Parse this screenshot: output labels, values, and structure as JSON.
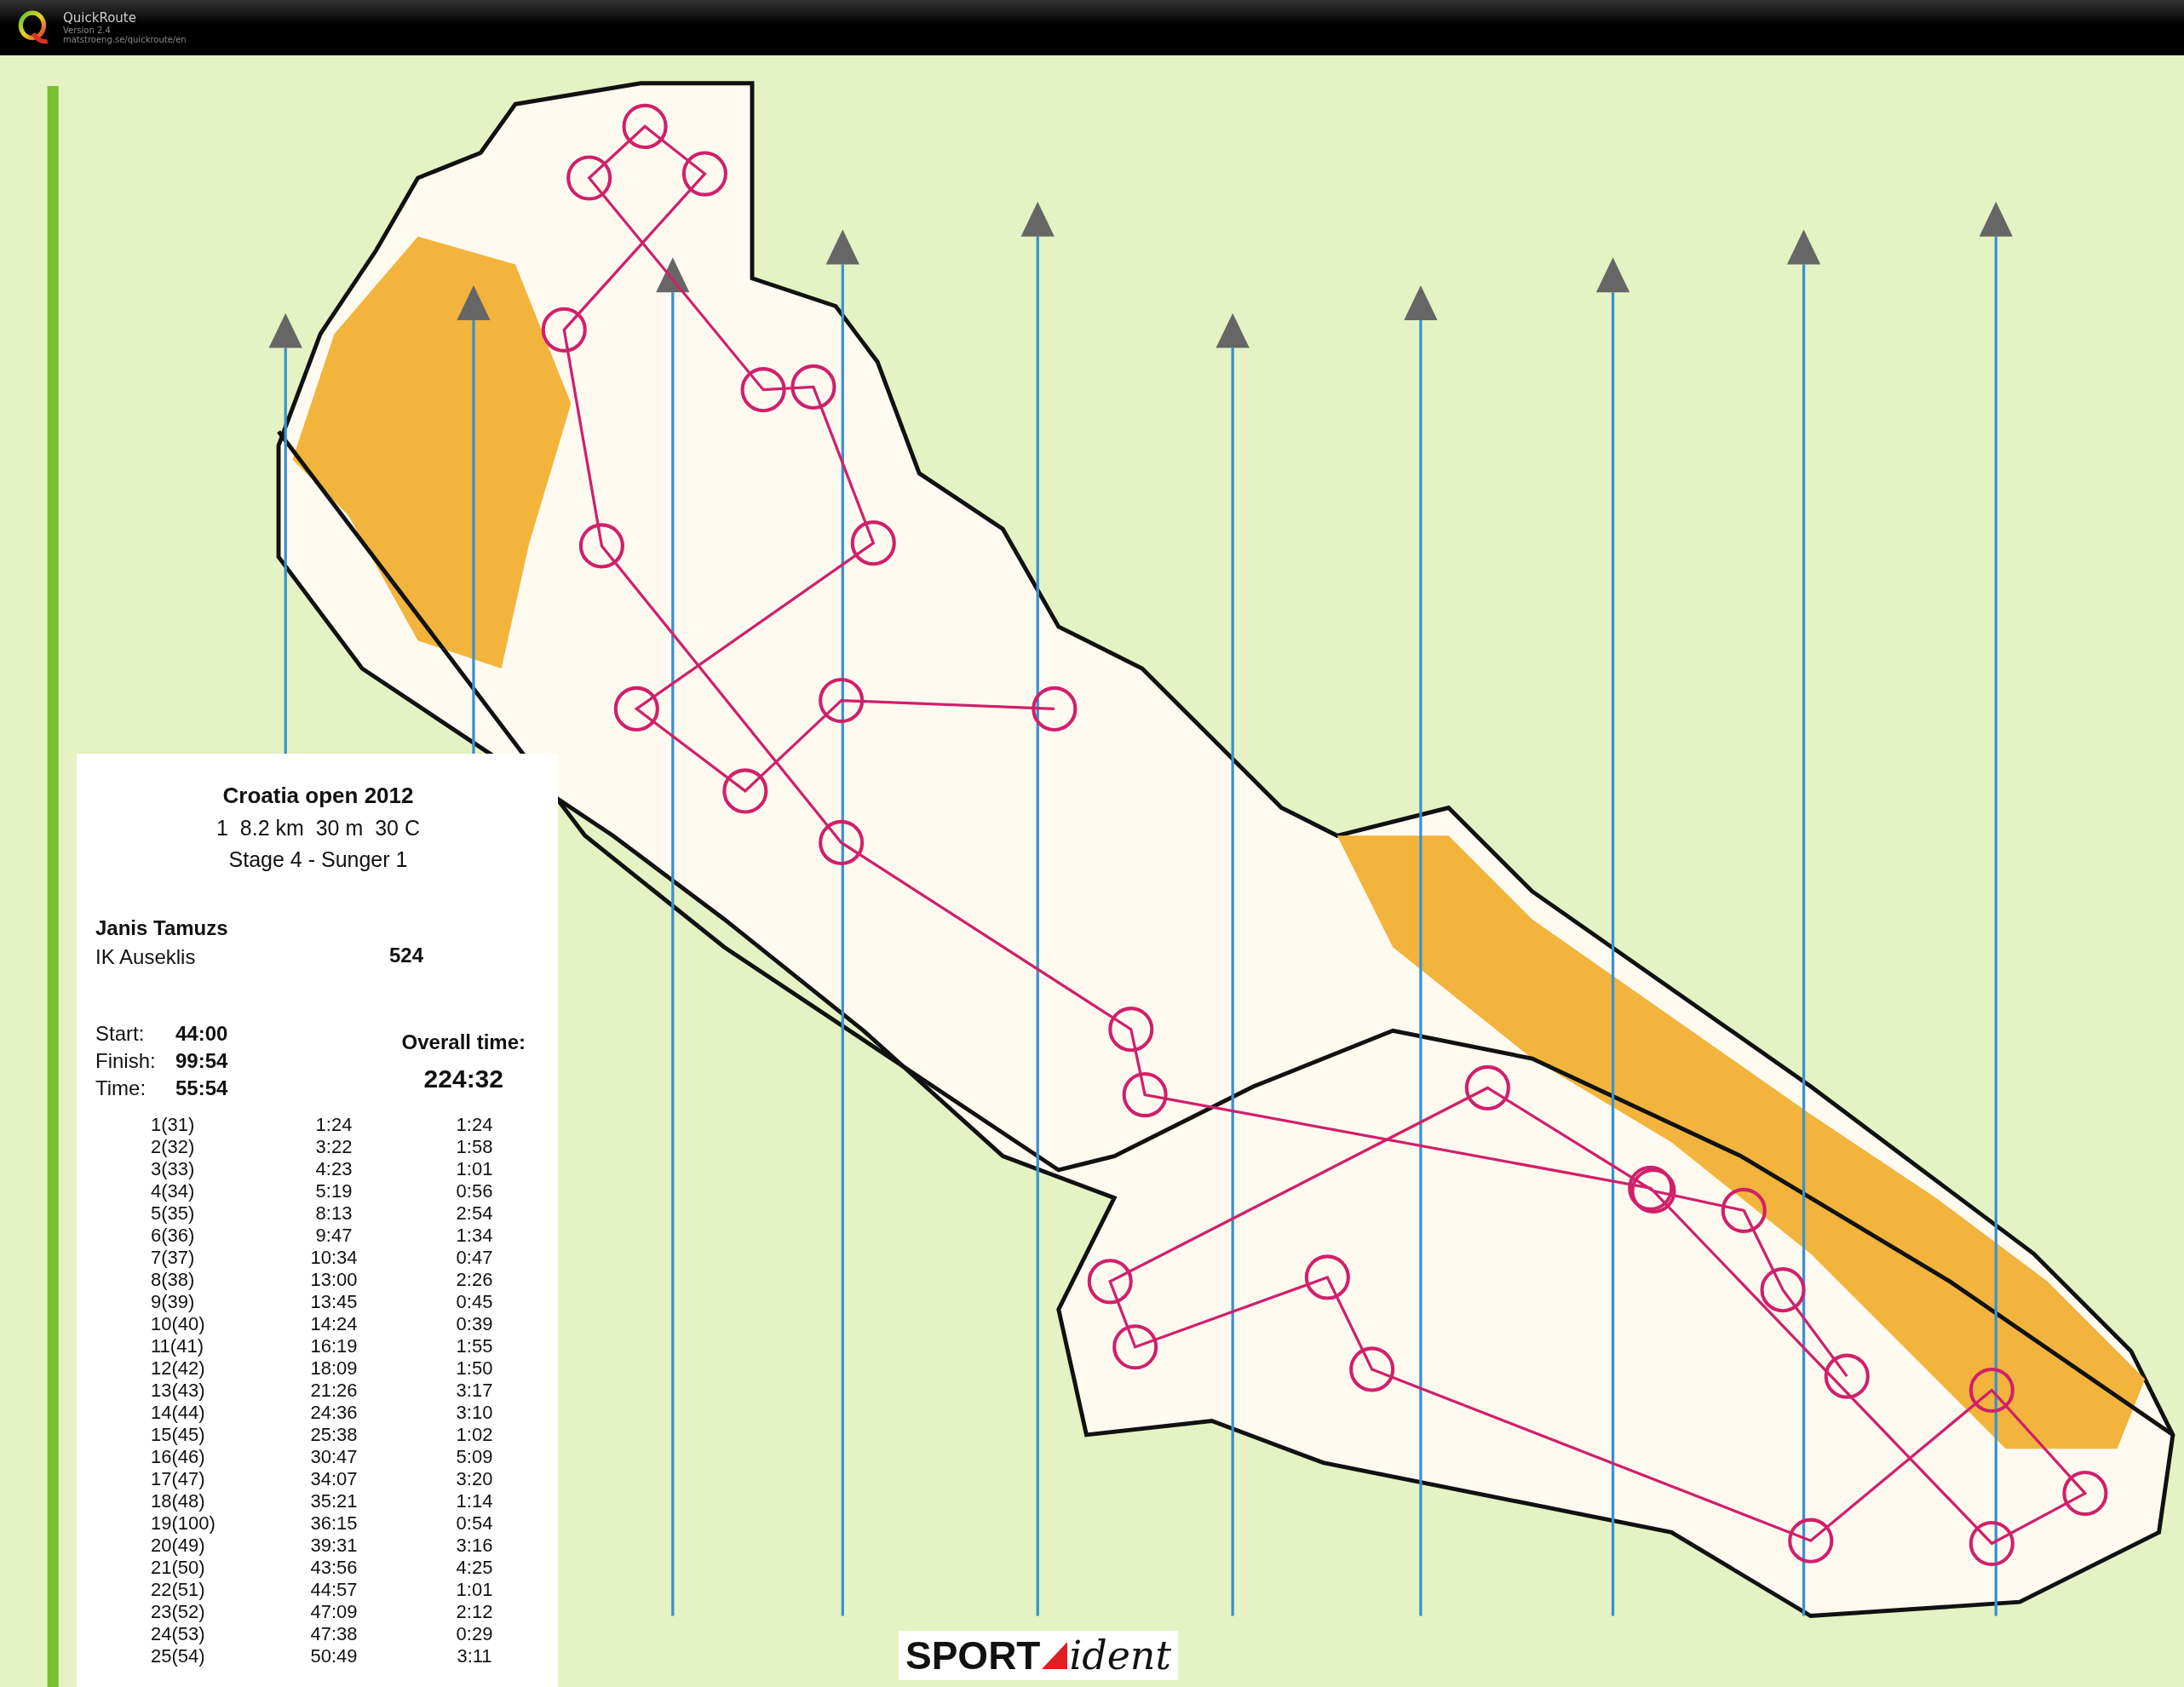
{
  "app": {
    "name": "QuickRoute",
    "version": "Version 2.4",
    "url": "matstroeng.se/quickroute/en"
  },
  "results": {
    "event": "Croatia open 2012",
    "course": "1  8.2 km  30 m  30 C",
    "stage": "Stage 4 - Sunger 1",
    "runner": "Janis Tamuzs",
    "club": "IK Auseklis",
    "bib": "524",
    "times": [
      {
        "label": "Start:",
        "value": "44:00"
      },
      {
        "label": "Finish:",
        "value": "99:54"
      },
      {
        "label": "Time:",
        "value": "55:54"
      }
    ],
    "overall": {
      "label": "Overall time:",
      "value": "224:32"
    },
    "splits": [
      {
        "control": "1(31)",
        "elapsed": "1:24",
        "leg": "1:24"
      },
      {
        "control": "2(32)",
        "elapsed": "3:22",
        "leg": "1:58"
      },
      {
        "control": "3(33)",
        "elapsed": "4:23",
        "leg": "1:01"
      },
      {
        "control": "4(34)",
        "elapsed": "5:19",
        "leg": "0:56"
      },
      {
        "control": "5(35)",
        "elapsed": "8:13",
        "leg": "2:54"
      },
      {
        "control": "6(36)",
        "elapsed": "9:47",
        "leg": "1:34"
      },
      {
        "control": "7(37)",
        "elapsed": "10:34",
        "leg": "0:47"
      },
      {
        "control": "8(38)",
        "elapsed": "13:00",
        "leg": "2:26"
      },
      {
        "control": "9(39)",
        "elapsed": "13:45",
        "leg": "0:45"
      },
      {
        "control": "10(40)",
        "elapsed": "14:24",
        "leg": "0:39"
      },
      {
        "control": "11(41)",
        "elapsed": "16:19",
        "leg": "1:55"
      },
      {
        "control": "12(42)",
        "elapsed": "18:09",
        "leg": "1:50"
      },
      {
        "control": "13(43)",
        "elapsed": "21:26",
        "leg": "3:17"
      },
      {
        "control": "14(44)",
        "elapsed": "24:36",
        "leg": "3:10"
      },
      {
        "control": "15(45)",
        "elapsed": "25:38",
        "leg": "1:02"
      },
      {
        "control": "16(46)",
        "elapsed": "30:47",
        "leg": "5:09"
      },
      {
        "control": "17(47)",
        "elapsed": "34:07",
        "leg": "3:20"
      },
      {
        "control": "18(48)",
        "elapsed": "35:21",
        "leg": "1:14"
      },
      {
        "control": "19(100)",
        "elapsed": "36:15",
        "leg": "0:54"
      },
      {
        "control": "20(49)",
        "elapsed": "39:31",
        "leg": "3:16"
      },
      {
        "control": "21(50)",
        "elapsed": "43:56",
        "leg": "4:25"
      },
      {
        "control": "22(51)",
        "elapsed": "44:57",
        "leg": "1:01"
      },
      {
        "control": "23(52)",
        "elapsed": "47:09",
        "leg": "2:12"
      },
      {
        "control": "24(53)",
        "elapsed": "47:38",
        "leg": "0:29"
      },
      {
        "control": "25(54)",
        "elapsed": "50:49",
        "leg": "3:11"
      }
    ]
  },
  "sponsor": {
    "first": "SPORT",
    "second": "ident"
  }
}
